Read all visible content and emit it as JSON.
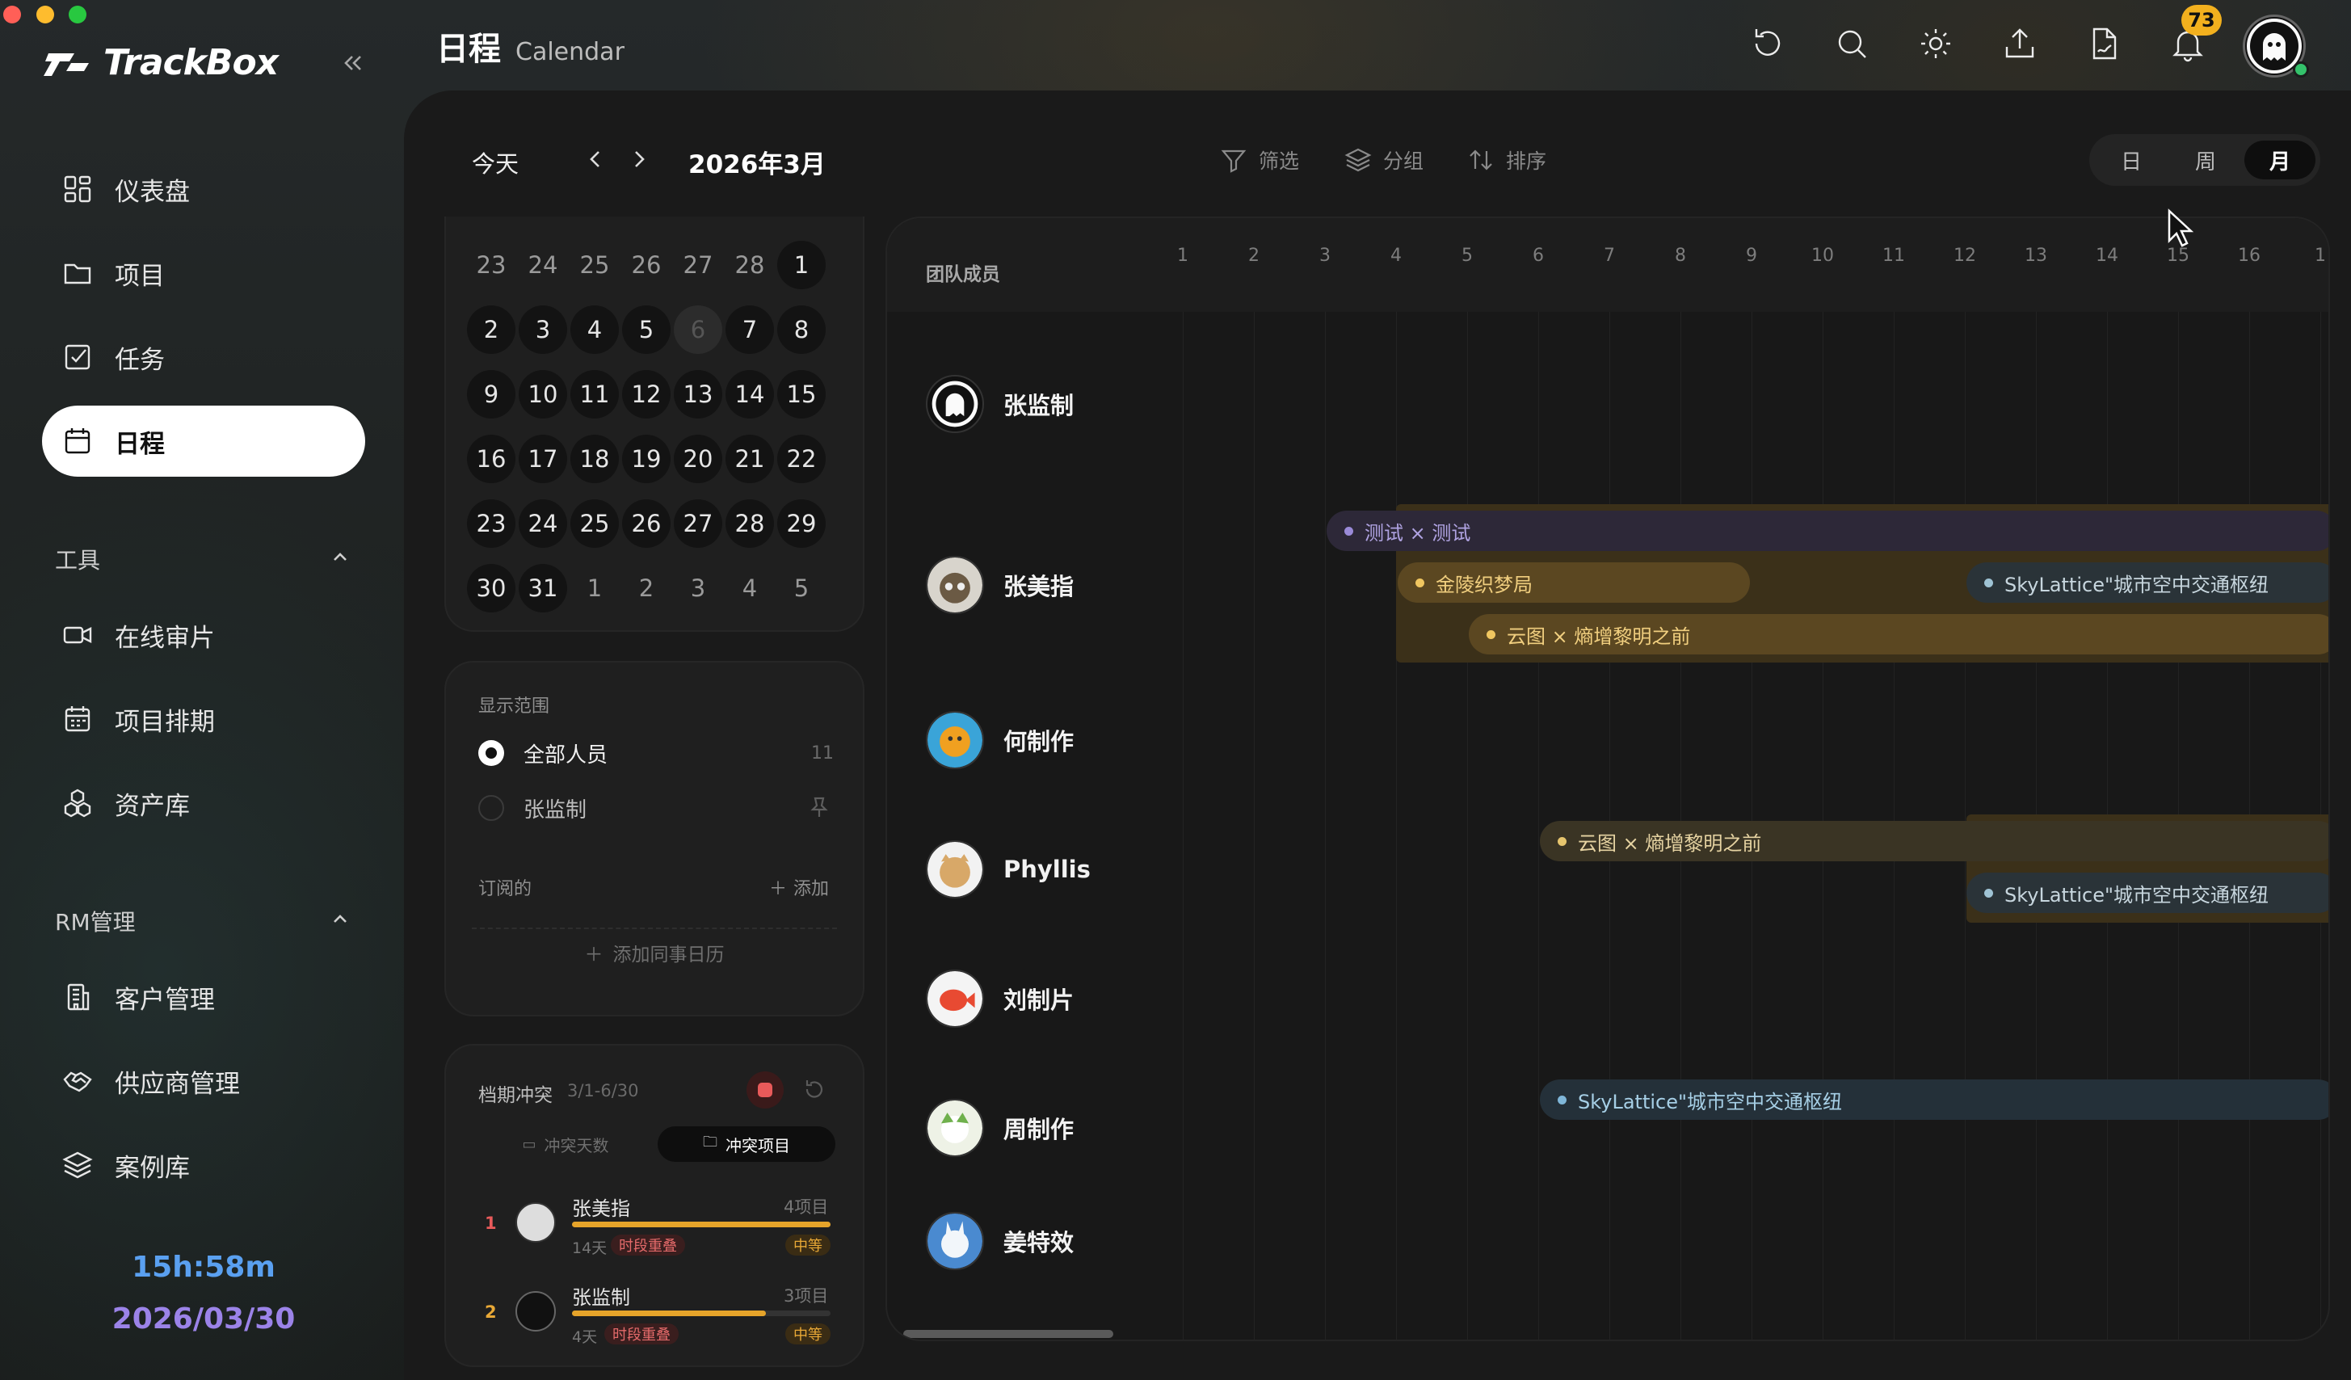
{
  "window": {
    "traffic_colors": [
      "#ff5f57",
      "#febc2e",
      "#28c840"
    ]
  },
  "sidebar": {
    "logo_text": "TrackBox",
    "collapse_icon": "chevrons-left-icon",
    "main_items": [
      {
        "label": "仪表盘",
        "icon": "dashboard-icon"
      },
      {
        "label": "项目",
        "icon": "folder-icon"
      },
      {
        "label": "任务",
        "icon": "checkbox-icon"
      },
      {
        "label": "日程",
        "icon": "calendar-icon",
        "active": true
      }
    ],
    "tools_title": "工具",
    "tools_items": [
      {
        "label": "在线审片",
        "icon": "video-icon"
      },
      {
        "label": "项目排期",
        "icon": "schedule-icon"
      },
      {
        "label": "资产库",
        "icon": "assets-icon"
      }
    ],
    "rm_title": "RM管理",
    "rm_items": [
      {
        "label": "客户管理",
        "icon": "building-icon"
      },
      {
        "label": "供应商管理",
        "icon": "handshake-icon"
      },
      {
        "label": "案例库",
        "icon": "layers-icon"
      }
    ],
    "timer": "15h:58m",
    "date": "2026/03/30"
  },
  "header": {
    "title": "日程",
    "subtitle": "Calendar",
    "notification_count": "73",
    "icons": [
      "refresh-icon",
      "search-icon",
      "sun-icon",
      "upload-icon",
      "file-sign-icon",
      "bell-icon"
    ]
  },
  "toolbar": {
    "today": "今天",
    "month_label": "2026年3月",
    "filter": "筛选",
    "group": "分组",
    "sort": "排序",
    "views": [
      "日",
      "周",
      "月"
    ],
    "active_view": "月"
  },
  "mini_calendar": {
    "weeks": [
      [
        "23",
        "24",
        "25",
        "26",
        "27",
        "28",
        "1"
      ],
      [
        "2",
        "3",
        "4",
        "5",
        "6",
        "7",
        "8"
      ],
      [
        "9",
        "10",
        "11",
        "12",
        "13",
        "14",
        "15"
      ],
      [
        "16",
        "17",
        "18",
        "19",
        "20",
        "21",
        "22"
      ],
      [
        "23",
        "24",
        "25",
        "26",
        "27",
        "28",
        "29"
      ],
      [
        "30",
        "31",
        "1",
        "2",
        "3",
        "4",
        "5"
      ]
    ]
  },
  "display_range": {
    "title": "显示范围",
    "all_members": "全部人员",
    "all_count": "11",
    "member": "张监制",
    "subscribed_title": "订阅的",
    "add": "添加",
    "add_colleague": "添加同事日历"
  },
  "conflicts": {
    "title": "档期冲突",
    "range": "3/1-6/30",
    "tab_days": "冲突天数",
    "tab_projects": "冲突项目",
    "rows": [
      {
        "rank": "1",
        "name": "张美指",
        "projects": "4项目",
        "days": "14天",
        "tag": "时段重叠",
        "level": "中等",
        "fill": 1.0
      },
      {
        "rank": "2",
        "name": "张监制",
        "projects": "3项目",
        "days": "4天",
        "tag": "时段重叠",
        "level": "中等",
        "fill": 0.75
      }
    ]
  },
  "gantt": {
    "header_label": "团队成员",
    "days": [
      "1",
      "2",
      "3",
      "4",
      "5",
      "6",
      "7",
      "8",
      "9",
      "10",
      "11",
      "12",
      "13",
      "14",
      "15",
      "16",
      "1"
    ],
    "members": [
      "张监制",
      "张美指",
      "何制作",
      "Phyllis",
      "刘制片",
      "周制作",
      "姜特效"
    ],
    "events": {
      "e1": "测试 × 测试",
      "e2": "金陵织梦局",
      "e3": "SkyLattice\"城市空中交通枢纽",
      "e4": "云图 × 熵增黎明之前",
      "e5": "云图 × 熵增黎明之前",
      "e6": "SkyLattice\"城市空中交通枢纽",
      "e7": "SkyLattice\"城市空中交通枢纽"
    }
  },
  "colors": {
    "accent_gold": "#f2b01e",
    "timer_blue": "#5aa0f0",
    "date_purple": "#9b83e8"
  }
}
